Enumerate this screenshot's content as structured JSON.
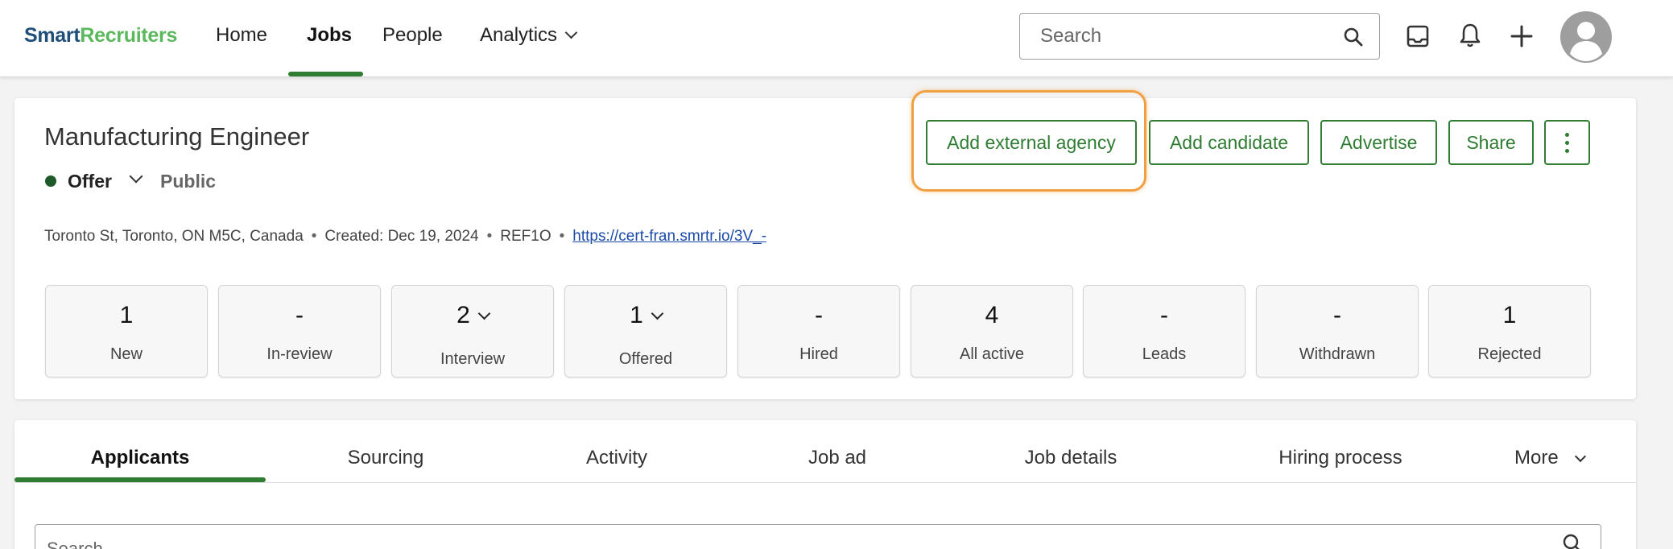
{
  "brand": {
    "part1": "Smart",
    "part2": "Recruiters"
  },
  "nav": {
    "home": "Home",
    "jobs": "Jobs",
    "people": "People",
    "analytics": "Analytics",
    "search_placeholder": "Search"
  },
  "job": {
    "title": "Manufacturing Engineer",
    "status": "Offer",
    "visibility": "Public",
    "location": "Toronto St, Toronto, ON M5C, Canada",
    "created": "Created: Dec 19, 2024",
    "ref": "REF1O",
    "url": "https://cert-fran.smrtr.io/3V_-"
  },
  "actions": {
    "add_agency": "Add external agency",
    "add_candidate": "Add candidate",
    "advertise": "Advertise",
    "share": "Share"
  },
  "stats": [
    {
      "value": "1",
      "label": "New"
    },
    {
      "value": "-",
      "label": "In-review"
    },
    {
      "value": "2",
      "label": "Interview"
    },
    {
      "value": "1",
      "label": "Offered"
    },
    {
      "value": "-",
      "label": "Hired"
    },
    {
      "value": "4",
      "label": "All active"
    },
    {
      "value": "-",
      "label": "Leads"
    },
    {
      "value": "-",
      "label": "Withdrawn"
    },
    {
      "value": "1",
      "label": "Rejected"
    }
  ],
  "tabs": [
    {
      "label": "Applicants"
    },
    {
      "label": "Sourcing"
    },
    {
      "label": "Activity"
    },
    {
      "label": "Job ad"
    },
    {
      "label": "Job details"
    },
    {
      "label": "Hiring process"
    },
    {
      "label": "More"
    }
  ],
  "applicants": {
    "search_placeholder": "Search"
  },
  "colors": {
    "accent": "#2e7d32",
    "brand_dark": "#1f4e79",
    "brand_light": "#5cb85c",
    "highlight": "#f0a040",
    "link": "#1a4ba8"
  }
}
